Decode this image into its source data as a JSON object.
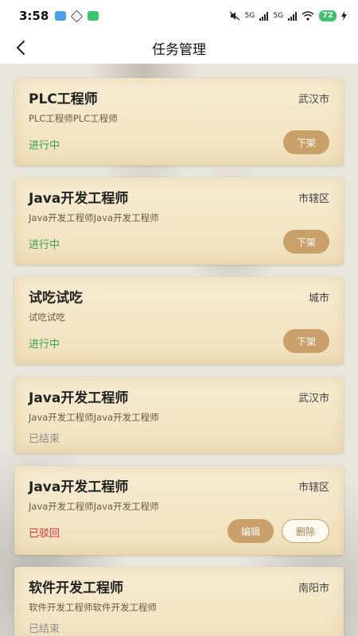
{
  "status_bar": {
    "time": "3:58",
    "network_1": "5G",
    "network_2": "5G",
    "battery": "72"
  },
  "header": {
    "title": "任务管理"
  },
  "tasks": [
    {
      "title": "PLC工程师",
      "location": "武汉市",
      "desc": "PLC工程师PLC工程师",
      "status": "进行中",
      "action": "下架"
    },
    {
      "title": "Java开发工程师",
      "location": "市辖区",
      "desc": "Java开发工程师Java开发工程师",
      "status": "进行中",
      "action": "下架"
    },
    {
      "title": "试吃试吃",
      "location": "城市",
      "desc": "试吃试吃",
      "status": "进行中",
      "action": "下架"
    },
    {
      "title": "Java开发工程师",
      "location": "武汉市",
      "desc": "Java开发工程师Java开发工程师",
      "status": "已结束"
    },
    {
      "title": "Java开发工程师",
      "location": "市辖区",
      "desc": "Java开发工程师Java开发工程师",
      "status": "已驳回",
      "edit": "编辑",
      "delete": "删除"
    },
    {
      "title": "软件开发工程师",
      "location": "南阳市",
      "desc": "软件开发工程师软件开发工程师",
      "status": "已结束"
    }
  ],
  "colors": {
    "active": "#3aa14a",
    "ended": "#8e8e8e",
    "rejected": "#d8333a",
    "accent": "#c9a06a"
  }
}
